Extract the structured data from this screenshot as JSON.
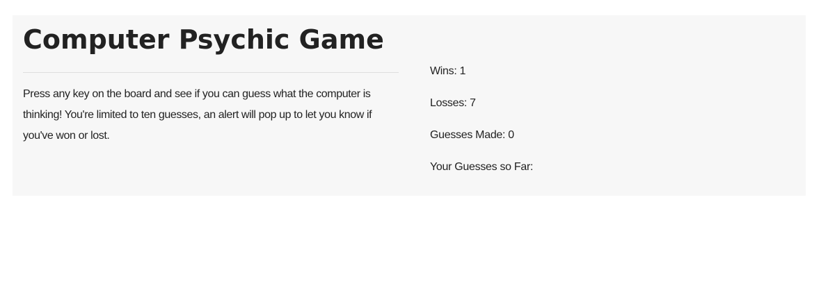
{
  "game": {
    "title": "Computer Psychic Game",
    "description": "Press any key on the board and see if you can guess what the computer is thinking! You're limited to ten guesses, an alert will pop up to let you know if you've won or lost."
  },
  "stats": {
    "wins": "Wins: 1",
    "losses": "Losses: 7",
    "guesses_made": "Guesses Made: 0",
    "guesses_so_far": "Your Guesses so Far:"
  }
}
